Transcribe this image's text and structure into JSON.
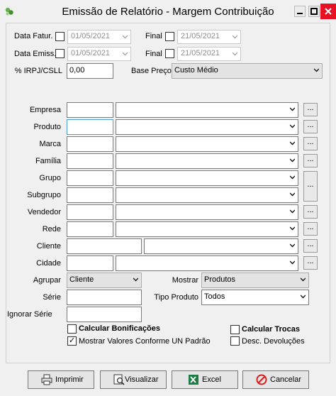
{
  "window": {
    "title": "Emissão de Relatório - Margem Contribuição"
  },
  "header": {
    "data_fatur_label": "Data Fatur.",
    "data_fatur_from": "01/05/2021",
    "data_fatur_final_label": "Final",
    "data_fatur_to": "21/05/2021",
    "data_emiss_label": "Data Emiss.",
    "data_emiss_from": "01/05/2021",
    "data_emiss_final_label": "Final",
    "data_emiss_to": "21/05/2021",
    "irpj_label": "% IRPJ/CSLL",
    "irpj_value": "0,00",
    "base_preco_label": "Base Preço",
    "base_preco_value": "Custo Médio"
  },
  "filters": {
    "empresa": "Empresa",
    "produto": "Produto",
    "marca": "Marca",
    "familia": "Família",
    "grupo": "Grupo",
    "subgrupo": "Subgrupo",
    "vendedor": "Vendedor",
    "rede": "Rede",
    "cliente": "Cliente",
    "cidade": "Cidade",
    "dots": "..."
  },
  "options": {
    "agrupar_label": "Agrupar",
    "agrupar_value": "Cliente",
    "mostrar_label": "Mostrar",
    "mostrar_value": "Produtos",
    "serie_label": "Série",
    "tipo_produto_label": "Tipo Produto",
    "tipo_produto_value": "Todos",
    "ignorar_serie_label": "Ignorar Série",
    "calcular_bonificacoes": "Calcular Bonificações",
    "calcular_trocas": "Calcular Trocas",
    "mostrar_valores": "Mostrar Valores Conforme UN Padrão",
    "desc_devolucoes": "Desc. Devoluções"
  },
  "buttons": {
    "imprimir": "Imprimir",
    "visualizar": "Visualizar",
    "excel": "Excel",
    "cancelar": "Cancelar"
  },
  "colors": {
    "close": "#e81123",
    "focus": "#4d9fd6",
    "excel": "#1d7b44",
    "cancel": "#d81e1e"
  }
}
